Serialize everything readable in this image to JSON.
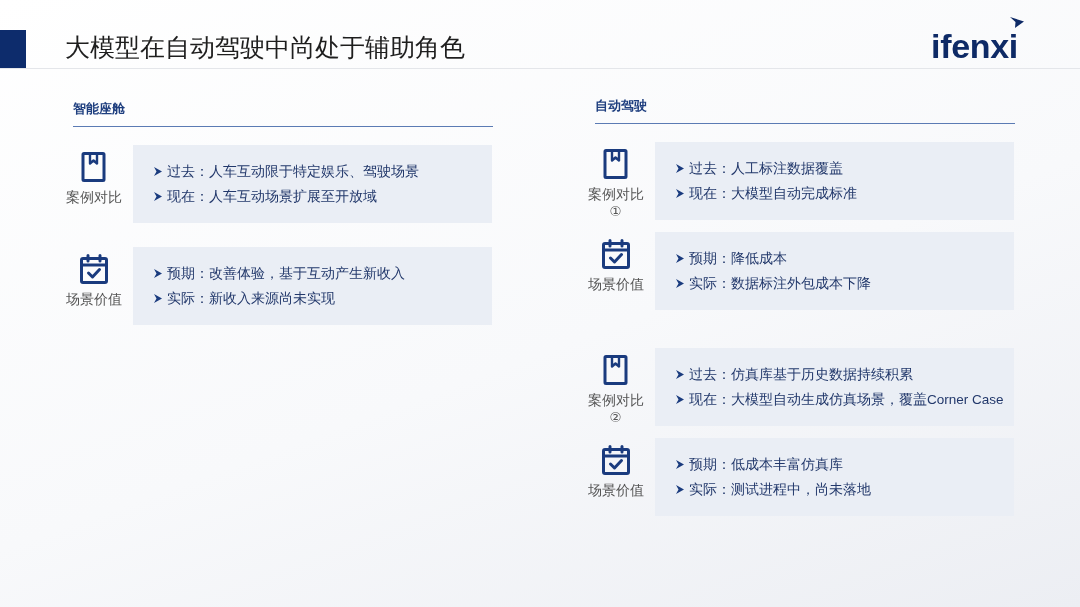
{
  "header": {
    "title": "大模型在自动驾驶中尚处于辅助角色",
    "logo": "ifenxi"
  },
  "sections": [
    {
      "heading": "智能座舱",
      "groups": [
        {
          "rows": [
            {
              "kind": "case",
              "label": "案例对比",
              "lines": [
                "过去：人车互动限于特定娱乐、驾驶场景",
                "现在：人车互动场景扩展至开放域"
              ]
            },
            {
              "kind": "value",
              "label": "场景价值",
              "lines": [
                "预期：改善体验，基于互动产生新收入",
                "实际：新收入来源尚未实现"
              ]
            }
          ]
        }
      ]
    },
    {
      "heading": "自动驾驶",
      "groups": [
        {
          "rows": [
            {
              "kind": "case",
              "label": "案例对比",
              "index": "①",
              "lines": [
                "过去：人工标注数据覆盖",
                "现在：大模型自动完成标准"
              ]
            },
            {
              "kind": "value",
              "label": "场景价值",
              "lines": [
                "预期：降低成本",
                "实际：数据标注外包成本下降"
              ]
            }
          ]
        },
        {
          "rows": [
            {
              "kind": "case",
              "label": "案例对比",
              "index": "②",
              "lines": [
                "过去：仿真库基于历史数据持续积累",
                "现在：大模型自动生成仿真场景，覆盖Corner Case"
              ]
            },
            {
              "kind": "value",
              "label": "场景价值",
              "lines": [
                "预期：低成本丰富仿真库",
                "实际：测试进程中，尚未落地"
              ]
            }
          ]
        }
      ]
    }
  ]
}
